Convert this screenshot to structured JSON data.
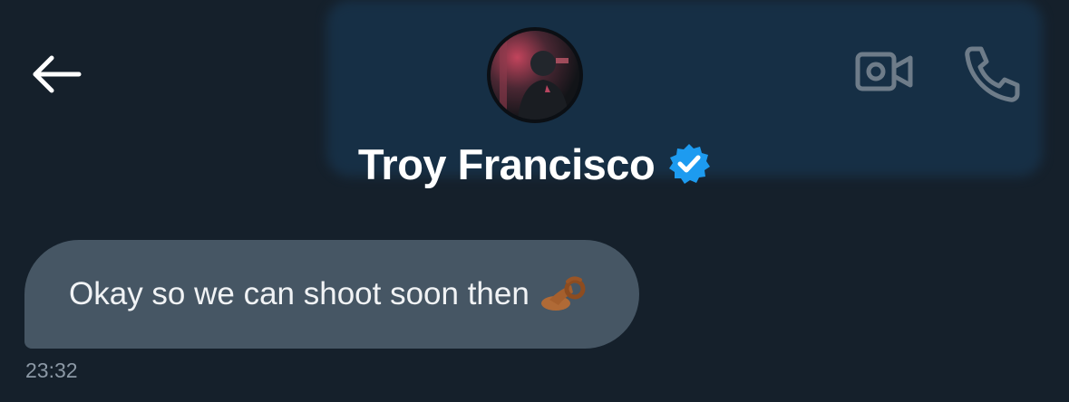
{
  "header": {
    "contact_name": "Troy Francisco",
    "verified": true,
    "back_icon": "arrow-left-icon",
    "video_icon": "video-camera-icon",
    "phone_icon": "phone-icon"
  },
  "messages": [
    {
      "text": "Okay so we can shoot soon then",
      "emoji": "👌🏾",
      "time": "23:32"
    }
  ],
  "colors": {
    "background": "#15202b",
    "bubble": "#465664",
    "verified_badge": "#1d9bf0",
    "timestamp": "#8b98a5",
    "icon_gray": "#6e7c89"
  }
}
